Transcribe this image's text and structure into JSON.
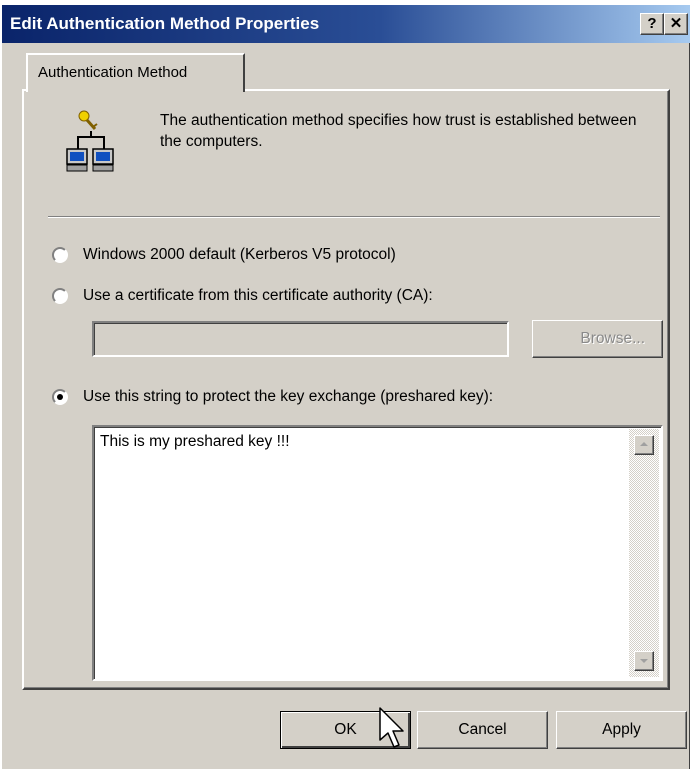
{
  "window": {
    "title": "Edit Authentication Method Properties",
    "help_glyph": "?",
    "close_glyph": "✕"
  },
  "tabs": [
    {
      "label": "Authentication Method",
      "selected": true
    }
  ],
  "header": {
    "icon": "network-computers-key-icon",
    "description": "The authentication method specifies how trust is established between the computers."
  },
  "options": [
    {
      "label": "Windows 2000 default (Kerberos V5 protocol)",
      "selected": false
    },
    {
      "label": "Use a certificate from this certificate authority (CA):",
      "selected": false
    },
    {
      "label": "Use this string to protect the key exchange (preshared key):",
      "selected": true
    }
  ],
  "ca": {
    "value": "",
    "browse_label": "Browse...",
    "browse_enabled": false
  },
  "preshared_key": {
    "value": "This is my preshared key !!!"
  },
  "buttons": {
    "ok": "OK",
    "cancel": "Cancel",
    "apply": "Apply"
  },
  "colors": {
    "titlebar_start": "#0a246a",
    "titlebar_end": "#a6caf0",
    "face": "#d4d0c8"
  }
}
